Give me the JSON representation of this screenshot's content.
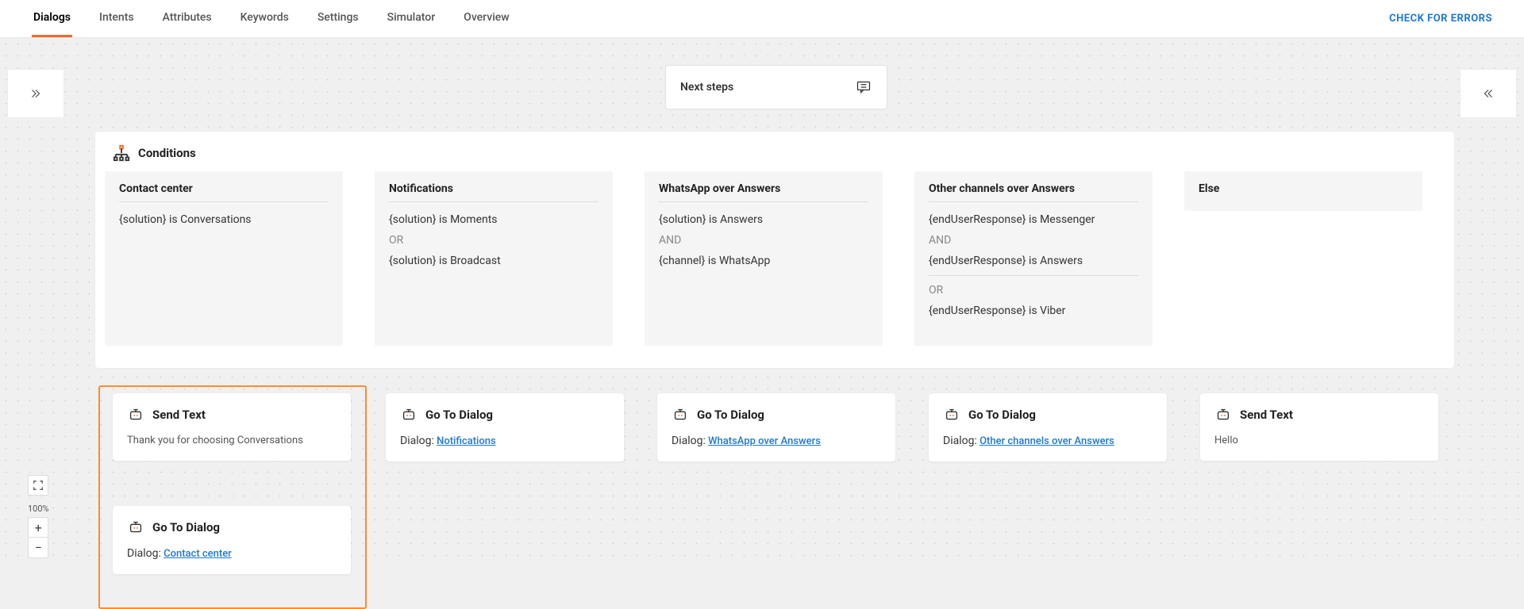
{
  "nav": {
    "tabs": [
      "Dialogs",
      "Intents",
      "Attributes",
      "Keywords",
      "Settings",
      "Simulator",
      "Overview"
    ],
    "activeIndex": 0,
    "checkErrors": "CHECK FOR ERRORS"
  },
  "header": {
    "nextSteps": "Next steps"
  },
  "conditions": {
    "title": "Conditions",
    "items": [
      {
        "title": "Contact center",
        "lines": [
          "{solution} is Conversations"
        ]
      },
      {
        "title": "Notifications",
        "lines": [
          "{solution} is Moments",
          "OR",
          "{solution} is Broadcast"
        ]
      },
      {
        "title": "WhatsApp over Answers",
        "lines": [
          "{solution} is Answers",
          "AND",
          "{channel} is WhatsApp"
        ]
      },
      {
        "title": "Other channels over Answers",
        "lines": [
          "{endUserResponse} is Messenger",
          "AND",
          "{endUserResponse} is Answers",
          "DIVIDER",
          "OR",
          "{endUserResponse} is Viber"
        ]
      },
      {
        "title": "Else",
        "else": true
      }
    ]
  },
  "steps": {
    "col1a": {
      "title": "Send Text",
      "body": "Thank you for choosing Conversations"
    },
    "col1b": {
      "title": "Go To Dialog",
      "label": "Dialog:",
      "link": "Contact center"
    },
    "col2": {
      "title": "Go To Dialog",
      "label": "Dialog:",
      "link": "Notifications"
    },
    "col3": {
      "title": "Go To Dialog",
      "label": "Dialog:",
      "link": "WhatsApp over Answers"
    },
    "col4": {
      "title": "Go To Dialog",
      "label": "Dialog:",
      "link": "Other channels over Answers"
    },
    "col5": {
      "title": "Send Text",
      "body": "Hello"
    }
  },
  "zoom": {
    "level": "100%"
  }
}
